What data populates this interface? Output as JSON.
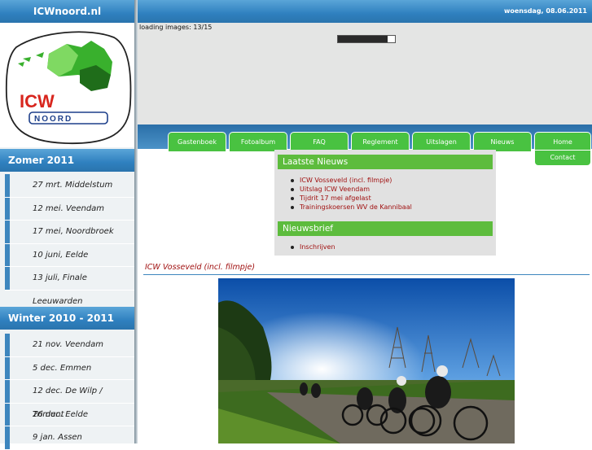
{
  "site_title": "ICWnoord.nl",
  "date_text": "woensdag, 08.06.2011",
  "logo": {
    "text_top": "ICW",
    "text_bottom": "NOORD"
  },
  "loading": {
    "text": "loading images: 13/15",
    "progress": 0.87
  },
  "nav": [
    "Gastenboek",
    "Fotoalbum",
    "FAQ",
    "Reglement",
    "Uitslagen",
    "Nieuws",
    "Home",
    "Contact"
  ],
  "sidebar": {
    "sections": [
      {
        "title": "Zomer 2011",
        "items": [
          "27 mrt. Middelstum",
          "12 mei. Veendam",
          "17 mei, Noordbroek",
          "10 juni, Eelde",
          "13 juli, Finale Leeuwarden"
        ]
      },
      {
        "title": "Winter 2010 - 2011",
        "items": [
          "21 nov. Veendam",
          "5 dec. Emmen",
          "12 dec. De Wilp / Trimunt",
          "26 dec. Eelde",
          "9 jan. Assen"
        ]
      }
    ]
  },
  "news": {
    "title": "Laatste Nieuws",
    "items": [
      "ICW Vosseveld (incl. filmpje)",
      "Uitslag ICW Veendam",
      "Tijdrit 17 mei afgelast",
      "Trainingskoersen WV de Kannibaal"
    ]
  },
  "newsletter": {
    "title": "Nieuwsbrief",
    "items": [
      "Inschrijven"
    ]
  },
  "article": {
    "title": "ICW Vosseveld (incl. filmpje)"
  },
  "colors": {
    "nav_green": "#49c241",
    "bar_blue": "#2f80bf",
    "link_red": "#a01010"
  }
}
